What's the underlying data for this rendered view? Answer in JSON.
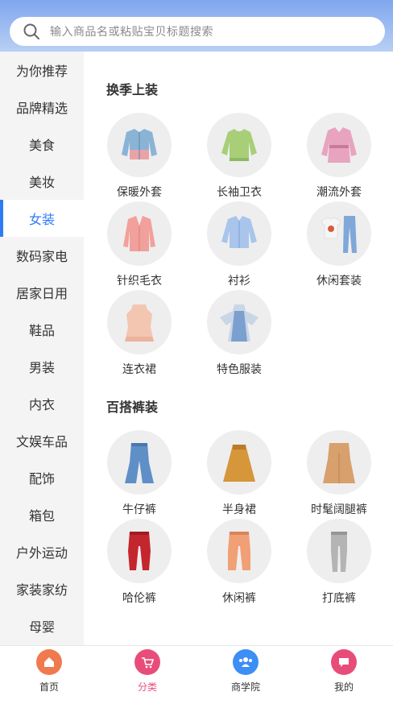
{
  "search": {
    "placeholder": "输入商品名或粘贴宝贝标题搜索"
  },
  "sidebar": {
    "items": [
      {
        "label": "为你推荐"
      },
      {
        "label": "品牌精选"
      },
      {
        "label": "美食"
      },
      {
        "label": "美妆"
      },
      {
        "label": "女装",
        "active": true
      },
      {
        "label": "数码家电"
      },
      {
        "label": "居家日用"
      },
      {
        "label": "鞋品"
      },
      {
        "label": "男装"
      },
      {
        "label": "内衣"
      },
      {
        "label": "文娱车品"
      },
      {
        "label": "配饰"
      },
      {
        "label": "箱包"
      },
      {
        "label": "户外运动"
      },
      {
        "label": "家装家纺"
      },
      {
        "label": "母婴"
      }
    ],
    "active_color": "#2f7bf5"
  },
  "sections": [
    {
      "title": "换季上装",
      "items": [
        {
          "label": "保暖外套",
          "icon": "denim-jacket-icon"
        },
        {
          "label": "长袖卫衣",
          "icon": "green-sweatshirt-icon"
        },
        {
          "label": "潮流外套",
          "icon": "pink-trench-coat-icon"
        },
        {
          "label": "针织毛衣",
          "icon": "pink-cardigan-icon"
        },
        {
          "label": "衬衫",
          "icon": "blue-shirt-icon"
        },
        {
          "label": "休闲套装",
          "icon": "tee-and-jeans-icon"
        },
        {
          "label": "连衣裙",
          "icon": "lace-dress-icon"
        },
        {
          "label": "特色服装",
          "icon": "hanfu-dress-icon"
        }
      ]
    },
    {
      "title": "百搭裤装",
      "items": [
        {
          "label": "牛仔裤",
          "icon": "flare-jeans-icon"
        },
        {
          "label": "半身裙",
          "icon": "mustard-skirt-icon"
        },
        {
          "label": "时髦阔腿裤",
          "icon": "wide-leg-pants-icon"
        },
        {
          "label": "哈伦裤",
          "icon": "red-joggers-icon"
        },
        {
          "label": "休闲裤",
          "icon": "orange-pants-icon"
        },
        {
          "label": "打底裤",
          "icon": "gray-leggings-icon"
        }
      ]
    }
  ],
  "tabbar": {
    "tabs": [
      {
        "label": "首页",
        "icon": "home-icon",
        "color": "#f07a4e"
      },
      {
        "label": "分类",
        "icon": "cart-icon",
        "color": "#e84d7a",
        "active": true
      },
      {
        "label": "商学院",
        "icon": "people-icon",
        "color": "#3d8ef5"
      },
      {
        "label": "我的",
        "icon": "chat-bubble-icon",
        "color": "#e84d7a"
      }
    ]
  }
}
